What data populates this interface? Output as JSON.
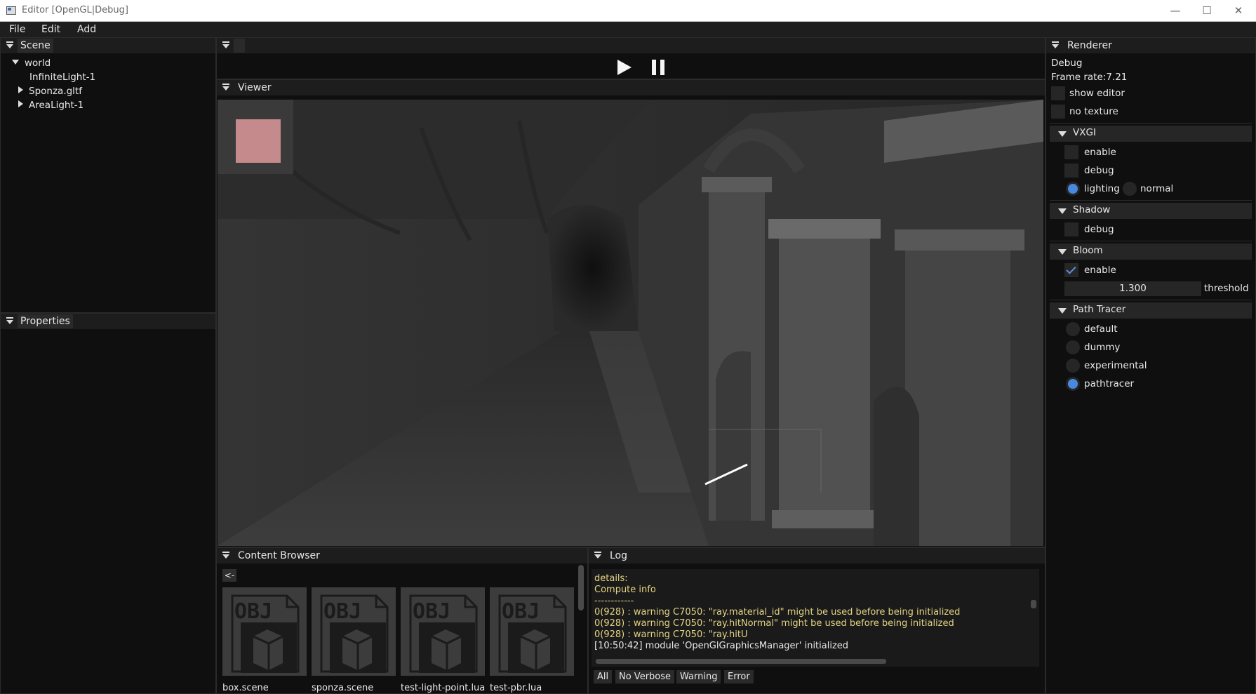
{
  "window": {
    "title": "Editor [OpenGL|Debug]",
    "minimize": "—",
    "maximize": "☐",
    "close": "✕"
  },
  "menu": [
    "File",
    "Edit",
    "Add"
  ],
  "scene_panel": {
    "title": "Scene",
    "items": [
      {
        "label": "world",
        "expanded": true
      },
      {
        "label": "InfiniteLight-1"
      },
      {
        "label": "Sponza.gltf",
        "expanded": false
      },
      {
        "label": "AreaLight-1",
        "expanded": false
      }
    ]
  },
  "properties_panel": {
    "title": "Properties"
  },
  "viewer_panel": {
    "title": "Viewer",
    "thumbnail_color": "#c48a8c"
  },
  "renderer": {
    "title": "Renderer",
    "mode": "Debug",
    "frame_rate": "Frame rate:7.21",
    "show_editor": {
      "label": "show editor",
      "checked": false
    },
    "no_texture": {
      "label": "no texture",
      "checked": false
    },
    "vxgi": {
      "title": "VXGI",
      "enable": {
        "label": "enable",
        "checked": false
      },
      "debug": {
        "label": "debug",
        "checked": false
      },
      "lighting": {
        "label": "lighting",
        "selected": true
      },
      "normal": {
        "label": "normal",
        "selected": false
      }
    },
    "shadow": {
      "title": "Shadow",
      "debug": {
        "label": "debug",
        "checked": false
      }
    },
    "bloom": {
      "title": "Bloom",
      "enable": {
        "label": "enable",
        "checked": true
      },
      "threshold_value": "1.300",
      "threshold_label": "threshold"
    },
    "path_tracer": {
      "title": "Path Tracer",
      "options": [
        {
          "label": "default",
          "selected": false
        },
        {
          "label": "dummy",
          "selected": false
        },
        {
          "label": "experimental",
          "selected": false
        },
        {
          "label": "pathtracer",
          "selected": true
        }
      ]
    }
  },
  "content_browser": {
    "title": "Content Browser",
    "back_label": "<-",
    "icon_text": "OBJ",
    "files": [
      "box.scene",
      "sponza.scene",
      "test-light-point.lua",
      "test-pbr.lua"
    ]
  },
  "log": {
    "title": "Log",
    "lines": [
      {
        "text": "details:",
        "color": "#e3d483"
      },
      {
        "text": "Compute info",
        "color": "#e3d483"
      },
      {
        "text": "------------",
        "color": "#e3d483"
      },
      {
        "text": "0(928) : warning C7050: \"ray.material_id\" might be used before being initialized",
        "color": "#e3d483"
      },
      {
        "text": "0(928) : warning C7050: \"ray.hitNormal\" might be used before being initialized",
        "color": "#e3d483"
      },
      {
        "text": "0(928) : warning C7050: \"ray.hitU",
        "color": "#e3d483"
      },
      {
        "text": "[10:50:42] module 'OpenGlGraphicsManager' initialized",
        "color": "#e8e8e8"
      }
    ],
    "filters": [
      "All",
      "No Verbose",
      "Warning",
      "Error"
    ]
  }
}
